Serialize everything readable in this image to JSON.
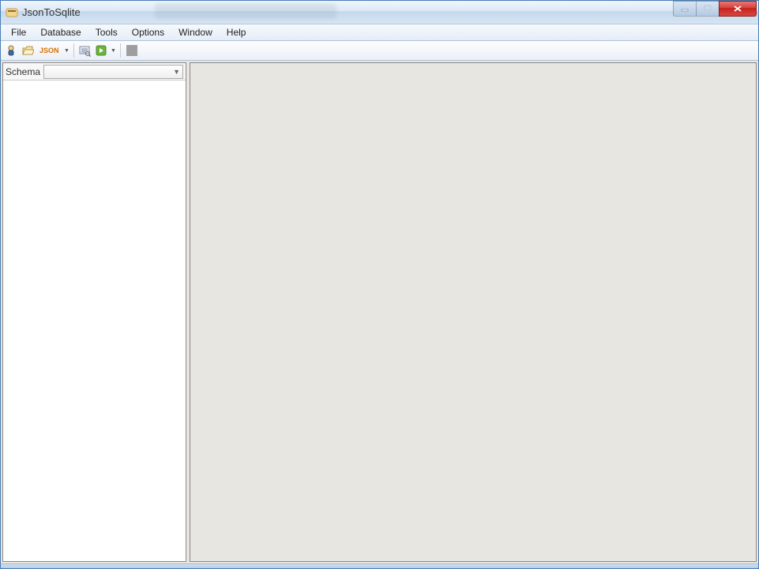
{
  "window": {
    "title": "JsonToSqlite"
  },
  "menu": {
    "items": [
      "File",
      "Database",
      "Tools",
      "Options",
      "Window",
      "Help"
    ]
  },
  "toolbar": {
    "json_label": "JSON"
  },
  "sidebar": {
    "schema_label": "Schema",
    "schema_value": ""
  }
}
